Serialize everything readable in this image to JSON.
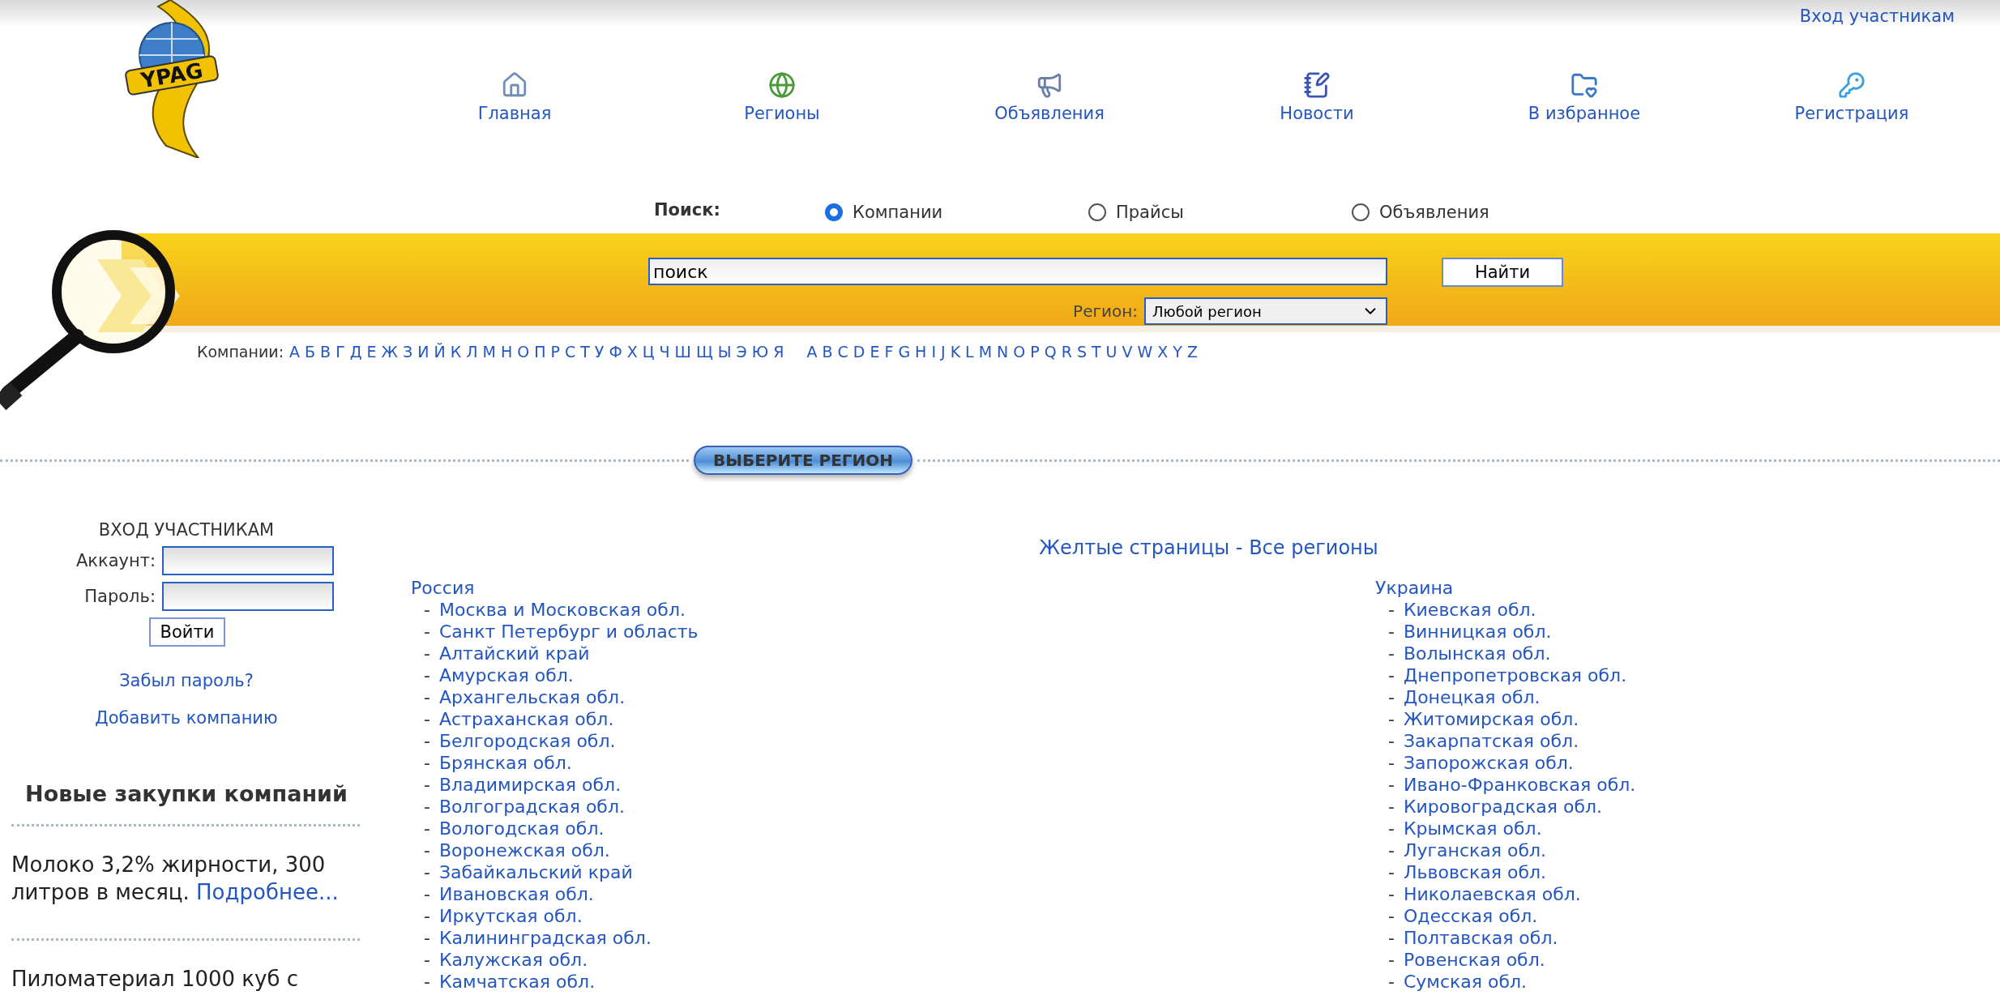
{
  "header": {
    "login_link": "Вход участникам",
    "logo_text": "YPAG",
    "nav": [
      {
        "kind": "home",
        "label": "Главная"
      },
      {
        "kind": "globe",
        "label": "Регионы"
      },
      {
        "kind": "megaphone",
        "label": "Объявления"
      },
      {
        "kind": "notepad",
        "label": "Новости"
      },
      {
        "kind": "favorites",
        "label": "В избранное"
      },
      {
        "kind": "key",
        "label": "Регистрация"
      }
    ]
  },
  "search": {
    "label": "Поиск:",
    "options": [
      {
        "label": "Компании",
        "selected": true
      },
      {
        "label": "Прайсы",
        "selected": false
      },
      {
        "label": "Объявления",
        "selected": false
      }
    ],
    "input": {
      "value": "поиск"
    },
    "button": "Найти",
    "region_label": "Регион:",
    "region_value": "Любой регион"
  },
  "alphabet": {
    "label": "Компании:",
    "cyrillic": [
      "А",
      "Б",
      "В",
      "Г",
      "Д",
      "Е",
      "Ж",
      "З",
      "И",
      "Й",
      "К",
      "Л",
      "М",
      "Н",
      "О",
      "П",
      "Р",
      "С",
      "Т",
      "У",
      "Ф",
      "Х",
      "Ц",
      "Ч",
      "Ш",
      "Щ",
      "Ы",
      "Э",
      "Ю",
      "Я"
    ],
    "latin": [
      "A",
      "B",
      "C",
      "D",
      "E",
      "F",
      "G",
      "H",
      "I",
      "J",
      "K",
      "L",
      "M",
      "N",
      "O",
      "P",
      "Q",
      "R",
      "S",
      "T",
      "U",
      "V",
      "W",
      "X",
      "Y",
      "Z"
    ]
  },
  "region_button": "ВЫБЕРИТЕ РЕГИОН",
  "sidebar": {
    "login": {
      "title": "ВХОД УЧАСТНИКАМ",
      "account_label": "Аккаунт:",
      "password_label": "Пароль:",
      "button": "Войти"
    },
    "forgot_link": "Забыл пароль?",
    "add_company_link": "Добавить компанию",
    "purchases_title": "Новые закупки компаний",
    "purchases": [
      {
        "text": "Молоко 3,2% жирности, 300 литров в месяц.",
        "link": "Подробнее..."
      },
      {
        "text": "Пиломатериал 1000 куб с"
      }
    ]
  },
  "main": {
    "title": "Желтые страницы - Все регионы",
    "countries": [
      {
        "name": "Россия",
        "regions": [
          {
            "bullet": "-",
            "name": "Москва и Московская обл."
          },
          {
            "bullet": "-",
            "name": "Санкт Петербург и область"
          },
          {
            "bullet": "-",
            "name": "Алтайский край"
          },
          {
            "bullet": "-",
            "name": "Амурская обл."
          },
          {
            "bullet": "-",
            "name": "Архангельская обл."
          },
          {
            "bullet": "-",
            "name": "Астраханская обл."
          },
          {
            "bullet": "-",
            "name": "Белгородская обл."
          },
          {
            "bullet": "-",
            "name": "Брянская обл."
          },
          {
            "bullet": "-",
            "name": "Владимирская обл."
          },
          {
            "bullet": "-",
            "name": "Волгоградская обл."
          },
          {
            "bullet": "-",
            "name": "Вологодская обл."
          },
          {
            "bullet": "-",
            "name": "Воронежская обл."
          },
          {
            "bullet": "-",
            "name": "Забайкальский край"
          },
          {
            "bullet": "-",
            "name": "Ивановская обл."
          },
          {
            "bullet": "-",
            "name": "Иркутская обл."
          },
          {
            "bullet": "-",
            "name": "Калининградская обл."
          },
          {
            "bullet": "-",
            "name": "Калужская обл."
          },
          {
            "bullet": "-",
            "name": "Камчатская обл."
          }
        ]
      },
      {
        "name": "Украина",
        "regions": [
          {
            "bullet": "-",
            "name": "Киевская обл."
          },
          {
            "bullet": "-",
            "name": "Винницкая обл."
          },
          {
            "bullet": "-",
            "name": "Волынская обл."
          },
          {
            "bullet": "-",
            "name": "Днепропетровская обл."
          },
          {
            "bullet": "-",
            "name": "Донецкая обл."
          },
          {
            "bullet": "-",
            "name": "Житомирская обл."
          },
          {
            "bullet": "-",
            "name": "Закарпатская обл."
          },
          {
            "bullet": "-",
            "name": "Запорожская обл."
          },
          {
            "bullet": "-",
            "name": "Ивано-Франковская обл."
          },
          {
            "bullet": "-",
            "name": "Кировоградская обл."
          },
          {
            "bullet": "-",
            "name": "Крымская обл."
          },
          {
            "bullet": "-",
            "name": "Луганская обл."
          },
          {
            "bullet": "-",
            "name": "Львовская обл."
          },
          {
            "bullet": "-",
            "name": "Николаевская обл."
          },
          {
            "bullet": "-",
            "name": "Одесская обл."
          },
          {
            "bullet": "-",
            "name": "Полтавская обл."
          },
          {
            "bullet": "-",
            "name": "Ровенская обл."
          },
          {
            "bullet": "-",
            "name": "Сумская обл."
          }
        ]
      }
    ]
  }
}
